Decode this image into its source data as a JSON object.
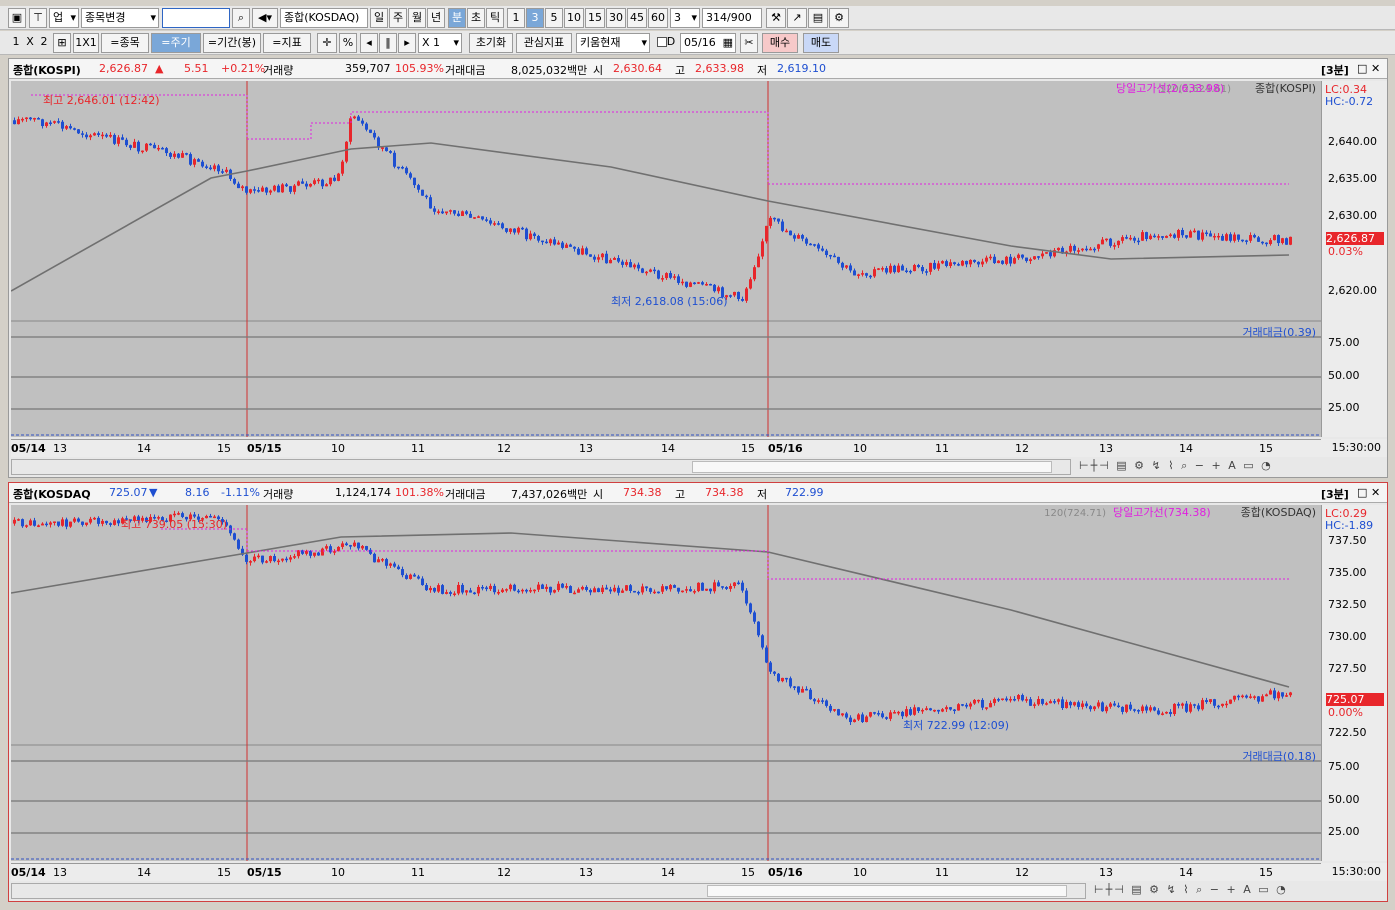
{
  "toolbar1": {
    "category": "업",
    "stock_change": "종목변경",
    "code": "101",
    "index_name": "종합(KOSDAQ)",
    "period_tabs": [
      "일",
      "주",
      "월",
      "년",
      "분",
      "초",
      "틱"
    ],
    "minute_tabs": [
      "1",
      "3",
      "5",
      "10",
      "15",
      "30",
      "45",
      "60"
    ],
    "interval": "3",
    "count": "314",
    "count_max": "/900"
  },
  "toolbar2": {
    "layout_1": "1",
    "layout_x": "X",
    "layout_2": "2",
    "one_by_one": "1X1",
    "stock_btn": "=종목",
    "period_btn": "=주기",
    "range_btn": "=기간(봉)",
    "indicator_btn": "=지표",
    "percent": "%",
    "multiplier": "X 1",
    "reset_btn": "초기화",
    "watch_btn": "관심지표",
    "kiwoom_btn": "키움현재",
    "d_label": "D",
    "date": "05/16",
    "buy_btn": "매수",
    "sell_btn": "매도"
  },
  "panels": [
    {
      "name": "종합(KOSPI)",
      "price": "2,626.87",
      "arrow": "▲",
      "change": "5.51",
      "change_pct": "+0.21%",
      "vol_label": "거래량",
      "volume": "359,707",
      "vol_pct": "105.93%",
      "amt_label": "거래대금",
      "amount": "8,025,032백만",
      "open_label": "시",
      "open": "2,630.64",
      "high_label": "고",
      "high": "2,633.98",
      "low_label": "저",
      "low": "2,619.10",
      "period": "[3분]",
      "ma_legend": "120(2,624.61)",
      "hl_legend": "당일고가선(2,633.98)",
      "series_legend": "종합(KOSPI)",
      "lc": "LC:0.34",
      "hc": "HC:-0.72",
      "y_ticks": [
        "2,640.00",
        "2,635.00",
        "2,630.00",
        "2,625.00",
        "2,620.00"
      ],
      "price_tag": "2,626.87",
      "pct_tag": "0.03%",
      "high_annot": "최고 2,646.01 (12:42)",
      "low_annot": "최저 2,618.08 (15:06)",
      "sub_legend": "거래대금(0.39)",
      "sub_ticks": [
        "75.00",
        "50.00",
        "25.00"
      ],
      "x_labels": [
        "05/14",
        "13",
        "14",
        "15",
        "05/15",
        "10",
        "11",
        "12",
        "13",
        "14",
        "15",
        "05/16",
        "10",
        "11",
        "12",
        "13",
        "14",
        "15"
      ],
      "x_time": "15:30:00",
      "colors": {
        "up": "#e8262b",
        "down": "#1e4fd1",
        "ma": "#707070",
        "hl": "#e020e0"
      },
      "chart_data": {
        "type": "line",
        "title": "",
        "x": [
          "05/14 13:00",
          "05/14 15:00",
          "05/15 09:00",
          "05/15 10:00",
          "05/15 12:42",
          "05/15 13:30",
          "05/15 15:06",
          "05/16 09:00",
          "05/16 10:00",
          "05/16 12:00",
          "05/16 13:30",
          "05/16 15:30"
        ],
        "series": [
          {
            "name": "종합(KOSPI)",
            "values": [
              2645,
              2638,
              2634,
              2636,
              2646,
              2632,
              2618.08,
              2630,
              2622,
              2624,
              2628,
              2626.87
            ]
          }
        ],
        "ylim": [
          2616,
          2650
        ]
      }
    },
    {
      "name": "종합(KOSDAQ",
      "price": "725.07",
      "arrow": "▼",
      "change": "8.16",
      "change_pct": "-1.11%",
      "vol_label": "거래량",
      "volume": "1,124,174",
      "vol_pct": "101.38%",
      "amt_label": "거래대금",
      "amount": "7,437,026백만",
      "open_label": "시",
      "open": "734.38",
      "high_label": "고",
      "high": "734.38",
      "low_label": "저",
      "low": "722.99",
      "period": "[3분]",
      "ma_legend": "120(724.71)",
      "hl_legend": "당일고가선(734.38)",
      "series_legend": "종합(KOSDAQ)",
      "lc": "LC:0.29",
      "hc": "HC:-1.89",
      "y_ticks": [
        "737.50",
        "735.00",
        "732.50",
        "730.00",
        "727.50",
        "725.00",
        "722.50"
      ],
      "price_tag": "725.07",
      "pct_tag": "0.00%",
      "high_annot": "최고 739.05 (15:30)",
      "low_annot": "최저 722.99 (12:09)",
      "sub_legend": "거래대금(0.18)",
      "sub_ticks": [
        "75.00",
        "50.00",
        "25.00"
      ],
      "x_labels": [
        "05/14",
        "13",
        "14",
        "15",
        "05/15",
        "10",
        "11",
        "12",
        "13",
        "14",
        "15",
        "05/16",
        "10",
        "11",
        "12",
        "13",
        "14",
        "15"
      ],
      "x_time": "15:30:00",
      "colors": {
        "up": "#e8262b",
        "down": "#1e4fd1",
        "ma": "#707070",
        "hl": "#e020e0"
      },
      "chart_data": {
        "type": "line",
        "title": "",
        "x": [
          "05/14 13:00",
          "05/14 15:30",
          "05/15 09:00",
          "05/15 11:00",
          "05/15 13:30",
          "05/15 15:00",
          "05/16 09:00",
          "05/16 10:00",
          "05/16 12:09",
          "05/16 13:00",
          "05/16 14:30",
          "05/16 15:30"
        ],
        "series": [
          {
            "name": "종합(KOSDAQ",
            "values": [
              738.5,
              739.05,
              735.5,
              736.5,
              736.8,
              733.2,
              733.5,
              726.5,
              722.99,
              724.5,
              723.5,
              725.07
            ]
          }
        ],
        "ylim": [
          721.5,
          739.5
        ]
      }
    }
  ]
}
